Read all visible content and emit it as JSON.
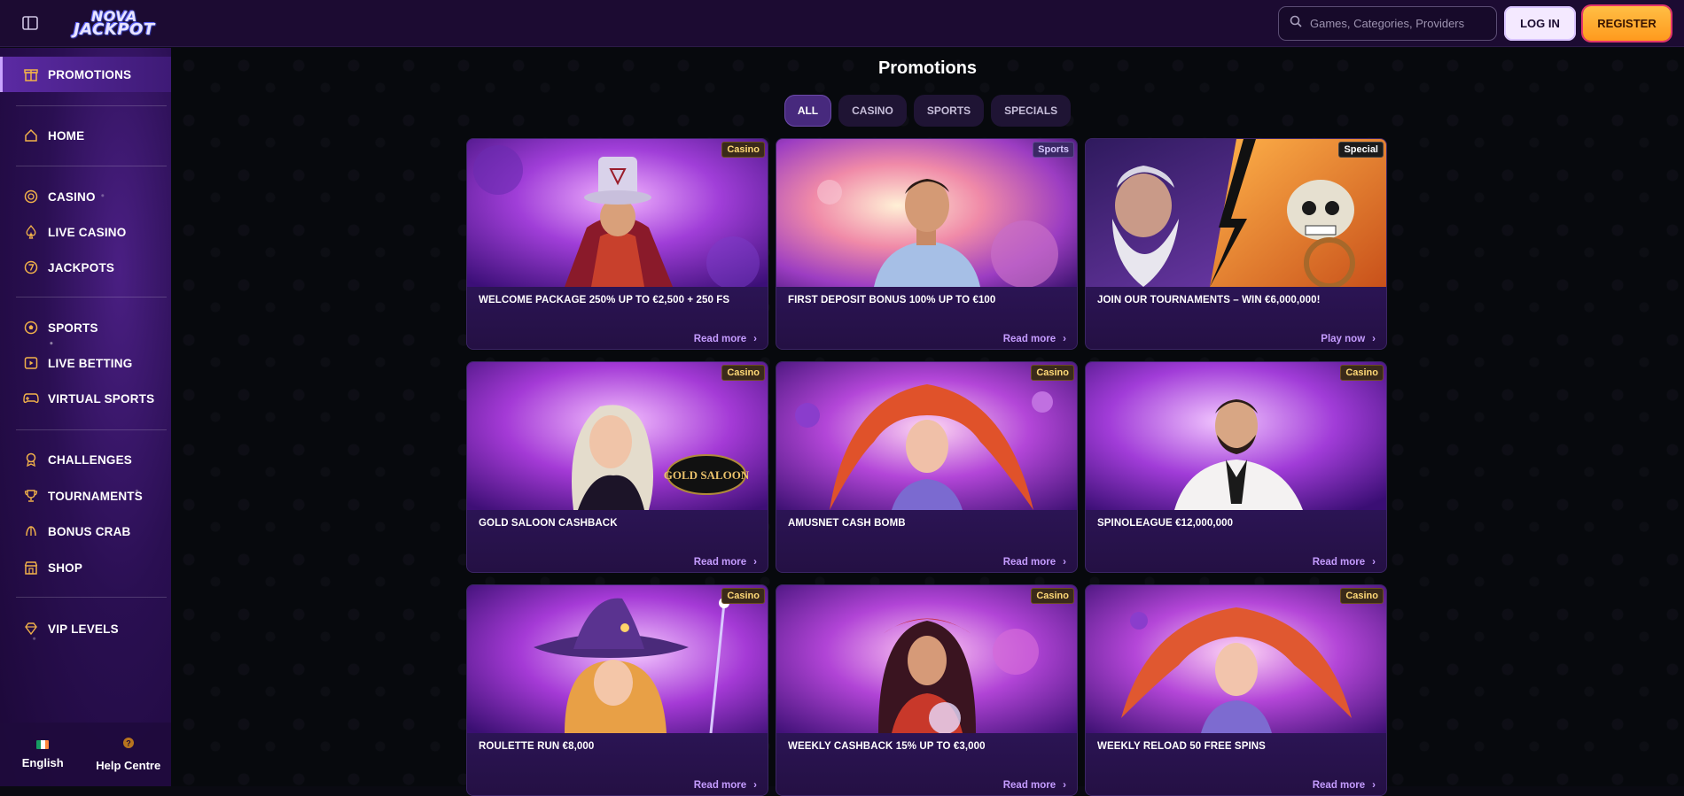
{
  "header": {
    "logo_line1": "NOVA",
    "logo_line2": "JACKPOT",
    "search_placeholder": "Games, Categories, Providers",
    "login_label": "LOG IN",
    "register_label": "REGISTER"
  },
  "sidebar": {
    "items": [
      {
        "label": "PROMOTIONS",
        "icon": "gift-shop-icon",
        "active": true
      },
      {
        "label": "HOME",
        "icon": "home-icon"
      },
      {
        "label": "CASINO",
        "icon": "chip-icon"
      },
      {
        "label": "LIVE CASINO",
        "icon": "spade-icon"
      },
      {
        "label": "JACKPOTS",
        "icon": "seven-icon"
      },
      {
        "label": "SPORTS",
        "icon": "football-icon"
      },
      {
        "label": "LIVE BETTING",
        "icon": "play-icon"
      },
      {
        "label": "VIRTUAL SPORTS",
        "icon": "gamepad-icon"
      },
      {
        "label": "CHALLENGES",
        "icon": "medal-icon"
      },
      {
        "label": "TOURNAMENTS",
        "icon": "trophy-icon"
      },
      {
        "label": "BONUS CRAB",
        "icon": "crab-icon"
      },
      {
        "label": "SHOP",
        "icon": "shop-icon"
      },
      {
        "label": "VIP LEVELS",
        "icon": "diamond-icon"
      }
    ],
    "footer": {
      "language": "English",
      "help": "Help Centre"
    }
  },
  "main": {
    "title": "Promotions",
    "tabs": [
      "ALL",
      "CASINO",
      "SPORTS",
      "SPECIALS"
    ],
    "active_tab": "ALL",
    "cards": [
      {
        "badge": "Casino",
        "title": "WELCOME PACKAGE 250% UP TO €2,500 + 250 FS",
        "action": "Read more"
      },
      {
        "badge": "Sports",
        "title": "FIRST DEPOSIT BONUS 100% UP TO €100",
        "action": "Read more"
      },
      {
        "badge": "Special",
        "title": "JOIN OUR TOURNAMENTS – WIN €6,000,000!",
        "action": "Play now"
      },
      {
        "badge": "Casino",
        "title": "GOLD SALOON CASHBACK",
        "action": "Read more",
        "art_text": "GOLD SALOON"
      },
      {
        "badge": "Casino",
        "title": "AMUSNET CASH BOMB",
        "action": "Read more"
      },
      {
        "badge": "Casino",
        "title": "SPINOLEAGUE €12,000,000",
        "action": "Read more"
      },
      {
        "badge": "Casino",
        "title": "ROULETTE RUN €8,000",
        "action": "Read more"
      },
      {
        "badge": "Casino",
        "title": "WEEKLY CASHBACK 15% UP TO €3,000",
        "action": "Read more"
      },
      {
        "badge": "Casino",
        "title": "WEEKLY RELOAD 50 FREE SPINS",
        "action": "Read more"
      }
    ]
  },
  "colors": {
    "accent": "#c59cff",
    "register": "#ff9a1e",
    "sidebar_bg": "#2a0f52"
  }
}
